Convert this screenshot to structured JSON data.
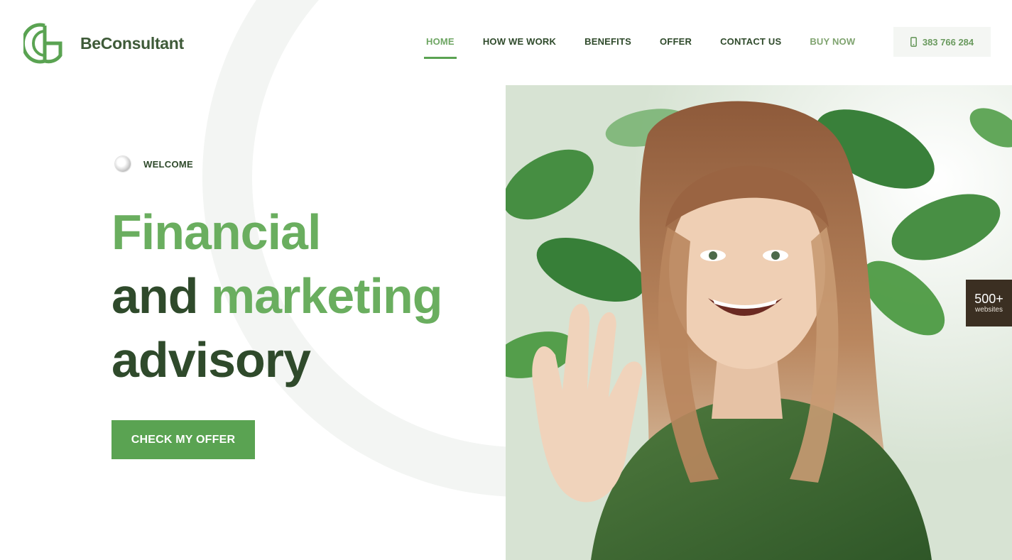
{
  "brand": {
    "name": "BeConsultant",
    "accent": "#5aa352",
    "dark": "#2f4a2b"
  },
  "nav": {
    "items": [
      {
        "label": "HOME",
        "active": true
      },
      {
        "label": "HOW WE WORK"
      },
      {
        "label": "BENEFITS"
      },
      {
        "label": "OFFER"
      },
      {
        "label": "CONTACT US"
      },
      {
        "label": "BUY NOW"
      }
    ],
    "phone": "383 766 284",
    "phone_icon": "mobile-phone-icon"
  },
  "hero": {
    "welcome": "WELCOME",
    "headline": {
      "line1": "Financial",
      "line2_a": "and ",
      "line2_b": "marketing",
      "line3": "advisory"
    },
    "cta": "CHECK MY OFFER",
    "image_alt": "Smiling woman waving in front of green plants"
  },
  "badge": {
    "count": "500+",
    "label": "websites"
  }
}
